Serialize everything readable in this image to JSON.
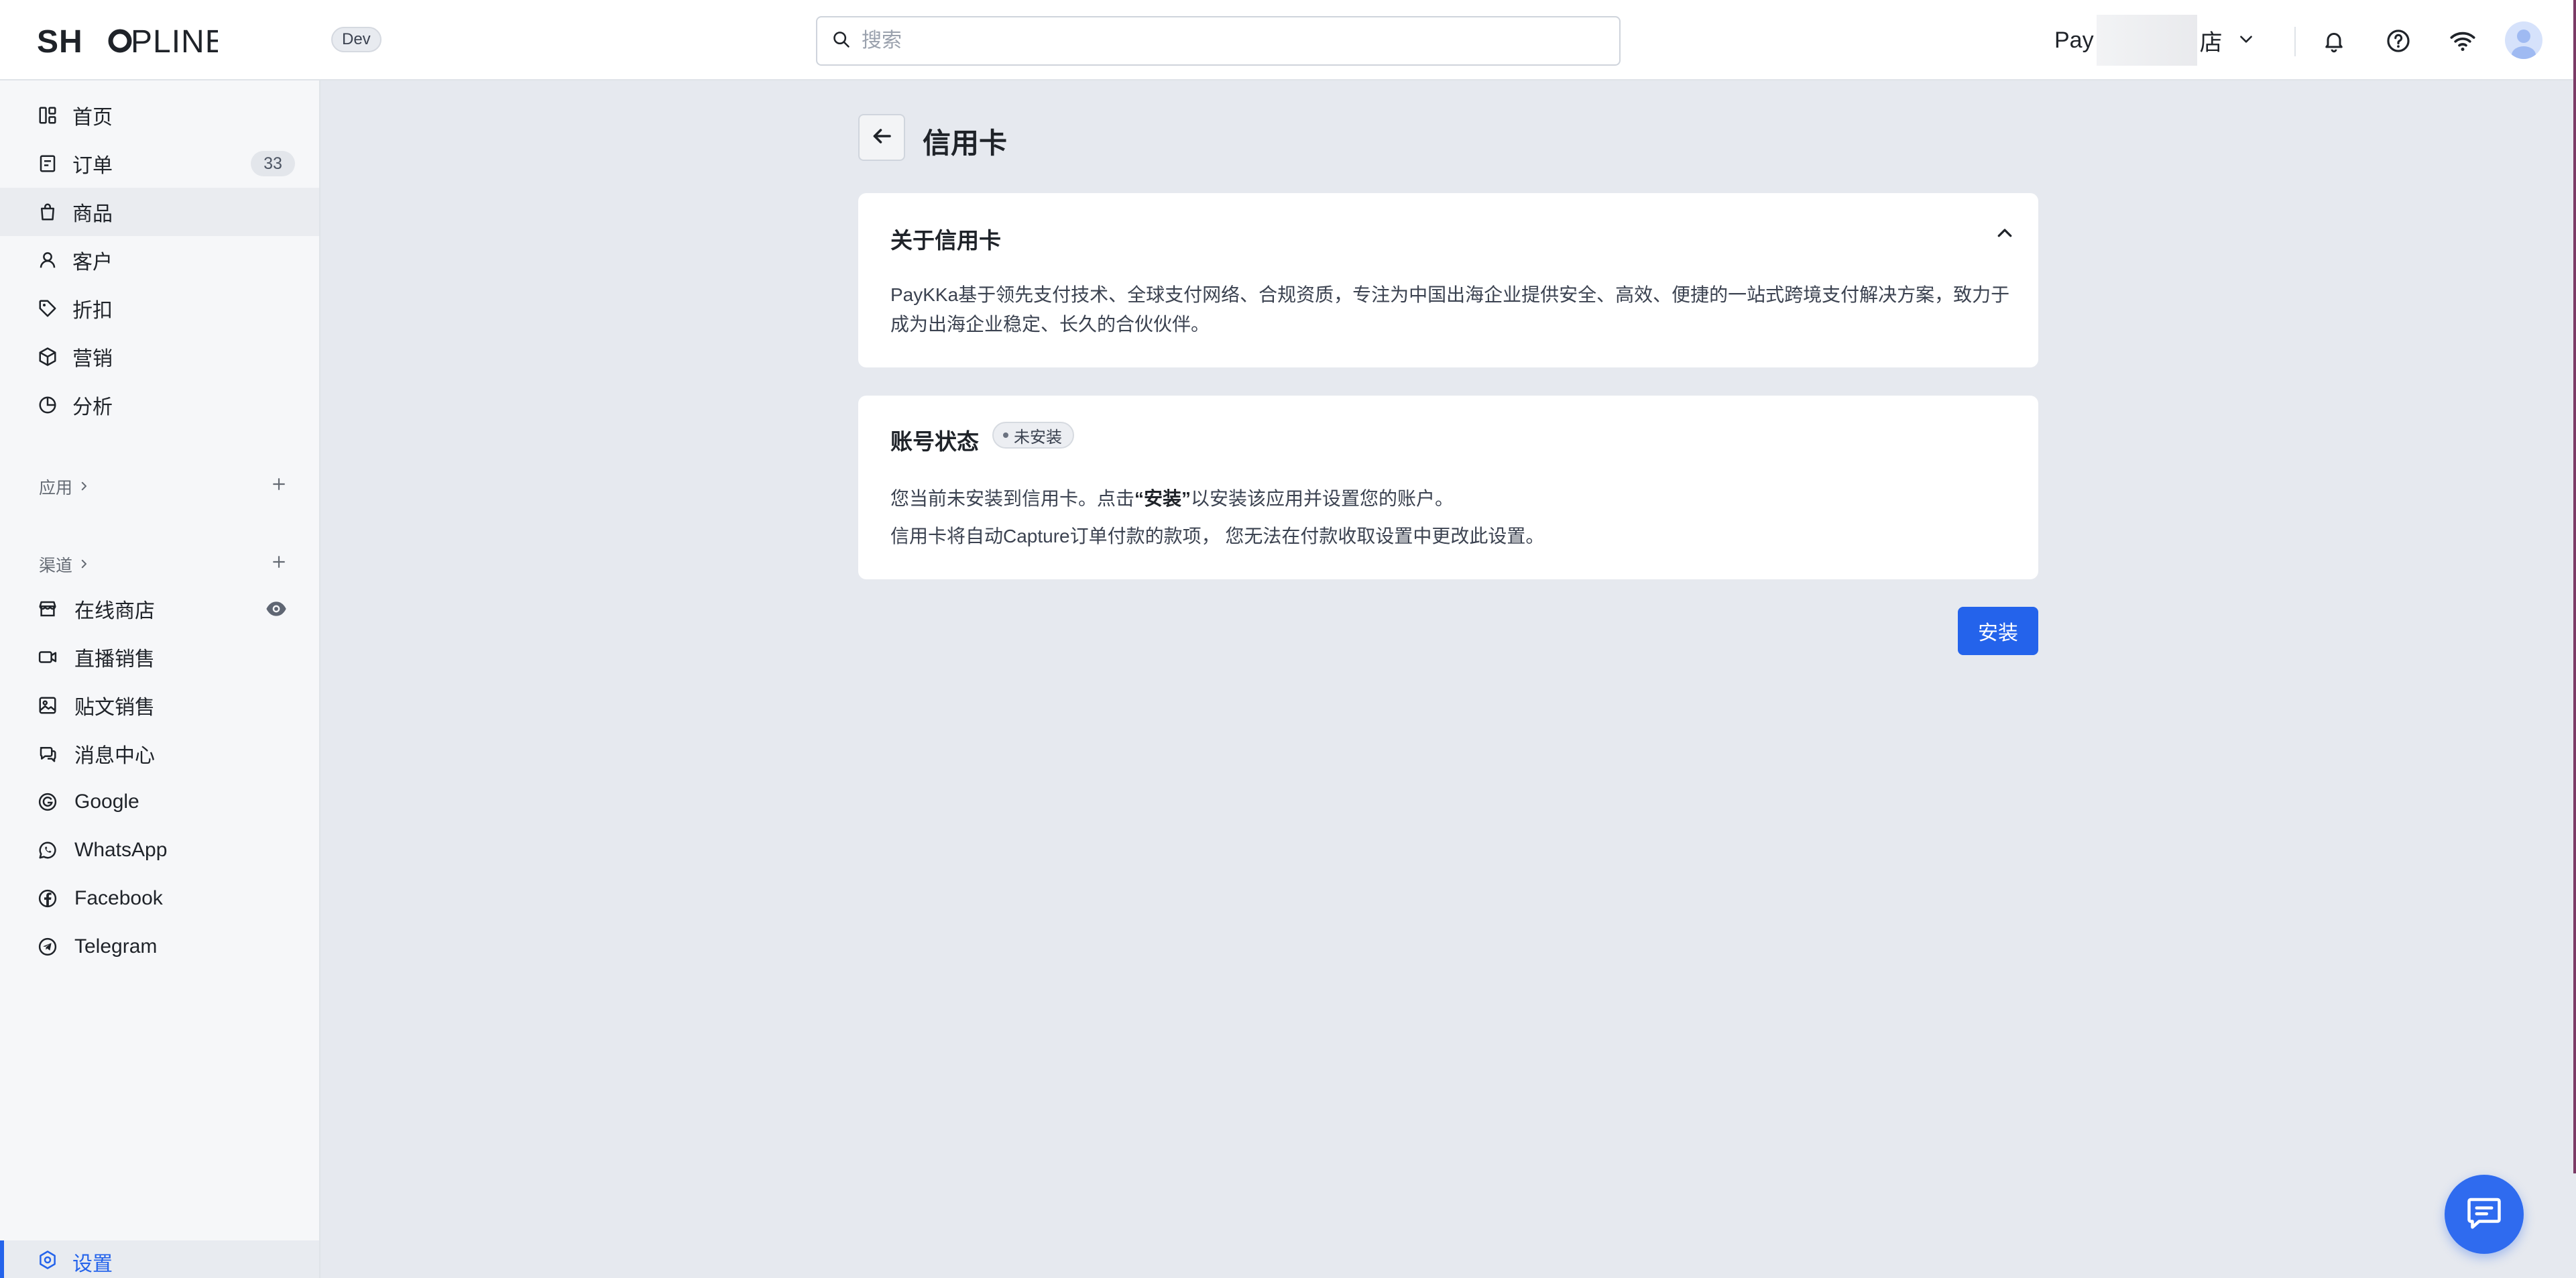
{
  "app": {
    "brand": "SHOPLINE",
    "env_badge": "Dev"
  },
  "header": {
    "search_placeholder": "搜索",
    "store_prefix": "Pay",
    "store_suffix": "店"
  },
  "sidebar": {
    "main_items": [
      {
        "label": "首页"
      },
      {
        "label": "订单",
        "count": "33"
      },
      {
        "label": "商品"
      },
      {
        "label": "客户"
      },
      {
        "label": "折扣"
      },
      {
        "label": "营销"
      },
      {
        "label": "分析"
      }
    ],
    "apps_section": "应用",
    "channels_section": "渠道",
    "channel_items": [
      {
        "label": "在线商店"
      },
      {
        "label": "直播销售"
      },
      {
        "label": "贴文销售"
      },
      {
        "label": "消息中心"
      },
      {
        "label": "Google"
      },
      {
        "label": "WhatsApp"
      },
      {
        "label": "Facebook"
      },
      {
        "label": "Telegram"
      }
    ],
    "settings_label": "设置"
  },
  "page": {
    "title": "信用卡",
    "about_card": {
      "title": "关于信用卡",
      "body": "PayKKa基于领先支付技术、全球支付网络、合规资质，专注为中国出海企业提供安全、高效、便捷的一站式跨境支付解决方案，致力于成为出海企业稳定、长久的合伙伙伴。"
    },
    "status_card": {
      "title": "账号状态",
      "status_badge": "未安装",
      "line1_before": "您当前未安装到信用卡。点击",
      "line1_bold": "“安装”",
      "line1_after": "以安装该应用并设置您的账户。",
      "line2": "信用卡将自动Capture订单付款的款项， 您无法在付款收取设置中更改此设置。"
    },
    "install_button": "安装"
  },
  "colors": {
    "accent": "#2463eb",
    "background": "#e6e9ef",
    "card": "#ffffff",
    "sidebar": "#f6f7f9"
  },
  "icons": {
    "search": "search-icon",
    "bell": "bell-icon",
    "help": "help-circle-icon",
    "wifi": "wifi-icon",
    "chat": "chat-icon"
  }
}
